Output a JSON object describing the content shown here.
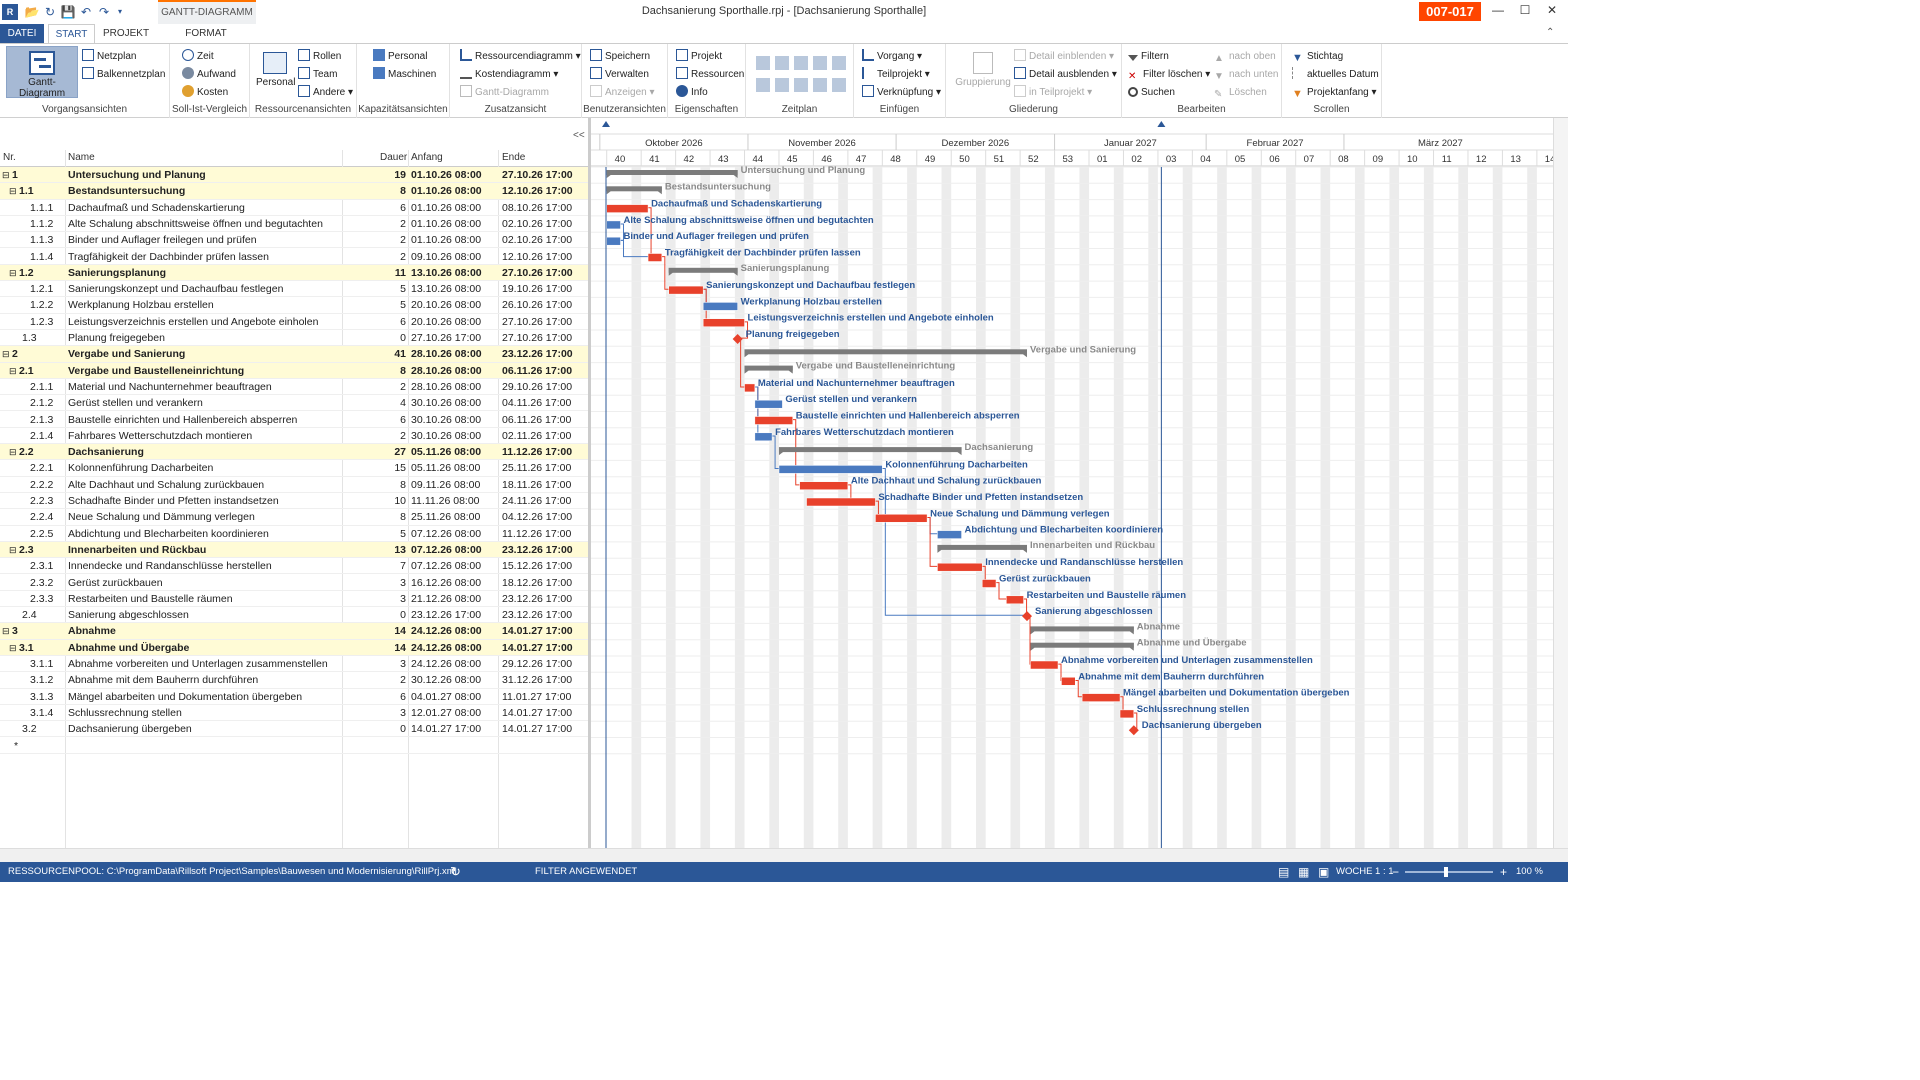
{
  "titlebar": {
    "title": "Dachsanierung Sporthalle.rpj - [Dachsanierung Sporthalle]",
    "badge": "007-017",
    "context_tab": "GANTT-DIAGRAMM"
  },
  "tabs": {
    "file": "DATEI",
    "start": "START",
    "projekt": "PROJEKT",
    "format": "FORMAT"
  },
  "ribbon": {
    "vorgang": {
      "label": "Vorgangsansichten",
      "gantt": "Gantt-Diagramm",
      "netzplan": "Netzplan",
      "balken": "Balkennetzplan"
    },
    "sollist": {
      "label": "Soll-Ist-Vergleich",
      "zeit": "Zeit",
      "aufwand": "Aufwand",
      "kosten": "Kosten"
    },
    "ressource": {
      "label": "Ressourcenansichten",
      "personal": "Personal",
      "rollen": "Rollen",
      "team": "Team",
      "andere": "Andere"
    },
    "kapazitaet": {
      "label": "Kapazitätsansichten",
      "personal": "Personal",
      "maschinen": "Maschinen"
    },
    "zusatz": {
      "label": "Zusatzansicht",
      "ressdiag": "Ressourcendiagramm",
      "kostendiag": "Kostendiagramm",
      "gantt": "Gantt-Diagramm"
    },
    "benutzer": {
      "label": "Benutzeransichten",
      "speichern": "Speichern",
      "verwalten": "Verwalten",
      "anzeigen": "Anzeigen"
    },
    "eigen": {
      "label": "Eigenschaften",
      "projekt": "Projekt",
      "ressourcen": "Ressourcen",
      "info": "Info"
    },
    "zeitplan": {
      "label": "Zeitplan"
    },
    "einfuegen": {
      "label": "Einfügen",
      "vorgang": "Vorgang",
      "teilprojekt": "Teilprojekt",
      "verknuepfung": "Verknüpfung"
    },
    "gliederung": {
      "label": "Gliederung",
      "gruppierung": "Gruppierung",
      "detail_ein": "Detail einblenden",
      "detail_aus": "Detail ausblenden",
      "in_teil": "in Teilprojekt"
    },
    "bearbeiten": {
      "label": "Bearbeiten",
      "filtern": "Filtern",
      "filter_loeschen": "Filter löschen",
      "suchen": "Suchen",
      "nach_oben": "nach oben",
      "nach_unten": "nach unten",
      "loeschen": "Löschen"
    },
    "scrollen": {
      "label": "Scrollen",
      "stichtag": "Stichtag",
      "aktuelles": "aktuelles Datum",
      "projektanfang": "Projektanfang"
    }
  },
  "table": {
    "headers": {
      "nr": "Nr.",
      "name": "Name",
      "dauer": "Dauer",
      "anfang": "Anfang",
      "ende": "Ende"
    },
    "collapse": "<<",
    "new_row": "*",
    "rows": [
      {
        "nr": "1",
        "name": "Untersuchung und Planung",
        "dur": "19",
        "start": "01.10.26 08:00",
        "end": "27.10.26 17:00",
        "lvl": 0,
        "sum": true,
        "s": 0,
        "e": 3.8
      },
      {
        "nr": "1.1",
        "name": "Bestandsuntersuchung",
        "dur": "8",
        "start": "01.10.26 08:00",
        "end": "12.10.26 17:00",
        "lvl": 1,
        "sum": true,
        "s": 0,
        "e": 1.6
      },
      {
        "nr": "1.1.1",
        "name": "Dachaufmaß und Schadenskartierung",
        "dur": "6",
        "start": "01.10.26 08:00",
        "end": "08.10.26 17:00",
        "lvl": 2,
        "c": "r",
        "s": 0,
        "e": 1.2
      },
      {
        "nr": "1.1.2",
        "name": "Alte Schalung abschnittsweise öffnen und begutachten",
        "dur": "2",
        "start": "01.10.26 08:00",
        "end": "02.10.26 17:00",
        "lvl": 2,
        "c": "b",
        "s": 0,
        "e": 0.4
      },
      {
        "nr": "1.1.3",
        "name": "Binder und Auflager freilegen und prüfen",
        "dur": "2",
        "start": "01.10.26 08:00",
        "end": "02.10.26 17:00",
        "lvl": 2,
        "c": "b",
        "s": 0,
        "e": 0.4
      },
      {
        "nr": "1.1.4",
        "name": "Tragfähigkeit der Dachbinder prüfen lassen",
        "dur": "2",
        "start": "09.10.26 08:00",
        "end": "12.10.26 17:00",
        "lvl": 2,
        "c": "r",
        "s": 1.2,
        "e": 1.6
      },
      {
        "nr": "1.2",
        "name": "Sanierungsplanung",
        "dur": "11",
        "start": "13.10.26 08:00",
        "end": "27.10.26 17:00",
        "lvl": 1,
        "sum": true,
        "s": 1.8,
        "e": 3.8
      },
      {
        "nr": "1.2.1",
        "name": "Sanierungskonzept und Dachaufbau festlegen",
        "dur": "5",
        "start": "13.10.26 08:00",
        "end": "19.10.26 17:00",
        "lvl": 2,
        "c": "r",
        "s": 1.8,
        "e": 2.8
      },
      {
        "nr": "1.2.2",
        "name": "Werkplanung Holzbau erstellen",
        "dur": "5",
        "start": "20.10.26 08:00",
        "end": "26.10.26 17:00",
        "lvl": 2,
        "c": "b",
        "s": 2.8,
        "e": 3.8
      },
      {
        "nr": "1.2.3",
        "name": "Leistungsverzeichnis erstellen und Angebote einholen",
        "dur": "6",
        "start": "20.10.26 08:00",
        "end": "27.10.26 17:00",
        "lvl": 2,
        "c": "r",
        "s": 2.8,
        "e": 4.0
      },
      {
        "nr": "1.3",
        "name": "Planung freigegeben",
        "dur": "0",
        "start": "27.10.26 17:00",
        "end": "27.10.26 17:00",
        "lvl": 1,
        "ms": true,
        "s": 3.8,
        "e": 3.8
      },
      {
        "nr": "2",
        "name": "Vergabe und Sanierung",
        "dur": "41",
        "start": "28.10.26 08:00",
        "end": "23.12.26 17:00",
        "lvl": 0,
        "sum": true,
        "s": 4.0,
        "e": 12.2
      },
      {
        "nr": "2.1",
        "name": "Vergabe und Baustelleneinrichtung",
        "dur": "8",
        "start": "28.10.26 08:00",
        "end": "06.11.26 17:00",
        "lvl": 1,
        "sum": true,
        "s": 4.0,
        "e": 5.4
      },
      {
        "nr": "2.1.1",
        "name": "Material und Nachunternehmer beauftragen",
        "dur": "2",
        "start": "28.10.26 08:00",
        "end": "29.10.26 17:00",
        "lvl": 2,
        "c": "r",
        "s": 4.0,
        "e": 4.3
      },
      {
        "nr": "2.1.2",
        "name": "Gerüst stellen und verankern",
        "dur": "4",
        "start": "30.10.26 08:00",
        "end": "04.11.26 17:00",
        "lvl": 2,
        "c": "b",
        "s": 4.3,
        "e": 5.1
      },
      {
        "nr": "2.1.3",
        "name": "Baustelle einrichten und Hallenbereich absperren",
        "dur": "6",
        "start": "30.10.26 08:00",
        "end": "06.11.26 17:00",
        "lvl": 2,
        "c": "r",
        "s": 4.3,
        "e": 5.4
      },
      {
        "nr": "2.1.4",
        "name": "Fahrbares Wetterschutzdach montieren",
        "dur": "2",
        "start": "30.10.26 08:00",
        "end": "02.11.26 17:00",
        "lvl": 2,
        "c": "b",
        "s": 4.3,
        "e": 4.8
      },
      {
        "nr": "2.2",
        "name": "Dachsanierung",
        "dur": "27",
        "start": "05.11.26 08:00",
        "end": "11.12.26 17:00",
        "lvl": 1,
        "sum": true,
        "s": 5.0,
        "e": 10.3
      },
      {
        "nr": "2.2.1",
        "name": "Kolonnenführung Dacharbeiten",
        "dur": "15",
        "start": "05.11.26 08:00",
        "end": "25.11.26 17:00",
        "lvl": 2,
        "c": "b",
        "s": 5.0,
        "e": 8.0
      },
      {
        "nr": "2.2.2",
        "name": "Alte Dachhaut und Schalung zurückbauen",
        "dur": "8",
        "start": "09.11.26 08:00",
        "end": "18.11.26 17:00",
        "lvl": 2,
        "c": "r",
        "s": 5.6,
        "e": 7.0
      },
      {
        "nr": "2.2.3",
        "name": "Schadhafte Binder und Pfetten instandsetzen",
        "dur": "10",
        "start": "11.11.26 08:00",
        "end": "24.11.26 17:00",
        "lvl": 2,
        "c": "r",
        "s": 5.8,
        "e": 7.8
      },
      {
        "nr": "2.2.4",
        "name": "Neue Schalung und Dämmung verlegen",
        "dur": "8",
        "start": "25.11.26 08:00",
        "end": "04.12.26 17:00",
        "lvl": 2,
        "c": "r",
        "s": 7.8,
        "e": 9.3
      },
      {
        "nr": "2.2.5",
        "name": "Abdichtung und Blecharbeiten koordinieren",
        "dur": "5",
        "start": "07.12.26 08:00",
        "end": "11.12.26 17:00",
        "lvl": 2,
        "c": "b",
        "s": 9.6,
        "e": 10.3
      },
      {
        "nr": "2.3",
        "name": "Innenarbeiten und Rückbau",
        "dur": "13",
        "start": "07.12.26 08:00",
        "end": "23.12.26 17:00",
        "lvl": 1,
        "sum": true,
        "s": 9.6,
        "e": 12.2
      },
      {
        "nr": "2.3.1",
        "name": "Innendecke und Randanschlüsse herstellen",
        "dur": "7",
        "start": "07.12.26 08:00",
        "end": "15.12.26 17:00",
        "lvl": 2,
        "c": "r",
        "s": 9.6,
        "e": 10.9
      },
      {
        "nr": "2.3.2",
        "name": "Gerüst zurückbauen",
        "dur": "3",
        "start": "16.12.26 08:00",
        "end": "18.12.26 17:00",
        "lvl": 2,
        "c": "r",
        "s": 10.9,
        "e": 11.3
      },
      {
        "nr": "2.3.3",
        "name": "Restarbeiten und Baustelle räumen",
        "dur": "3",
        "start": "21.12.26 08:00",
        "end": "23.12.26 17:00",
        "lvl": 2,
        "c": "r",
        "s": 11.6,
        "e": 12.1
      },
      {
        "nr": "2.4",
        "name": "Sanierung abgeschlossen",
        "dur": "0",
        "start": "23.12.26 17:00",
        "end": "23.12.26 17:00",
        "lvl": 1,
        "ms": true,
        "s": 12.2,
        "e": 12.2
      },
      {
        "nr": "3",
        "name": "Abnahme",
        "dur": "14",
        "start": "24.12.26 08:00",
        "end": "14.01.27 17:00",
        "lvl": 0,
        "sum": true,
        "s": 12.3,
        "e": 15.3
      },
      {
        "nr": "3.1",
        "name": "Abnahme und Übergabe",
        "dur": "14",
        "start": "24.12.26 08:00",
        "end": "14.01.27 17:00",
        "lvl": 1,
        "sum": true,
        "s": 12.3,
        "e": 15.3
      },
      {
        "nr": "3.1.1",
        "name": "Abnahme vorbereiten und Unterlagen zusammenstellen",
        "dur": "3",
        "start": "24.12.26 08:00",
        "end": "29.12.26 17:00",
        "lvl": 2,
        "c": "r",
        "s": 12.3,
        "e": 13.1
      },
      {
        "nr": "3.1.2",
        "name": "Abnahme mit dem Bauherrn durchführen",
        "dur": "2",
        "start": "30.12.26 08:00",
        "end": "31.12.26 17:00",
        "lvl": 2,
        "c": "r",
        "s": 13.2,
        "e": 13.6
      },
      {
        "nr": "3.1.3",
        "name": "Mängel abarbeiten und Dokumentation übergeben",
        "dur": "6",
        "start": "04.01.27 08:00",
        "end": "11.01.27 17:00",
        "lvl": 2,
        "c": "r",
        "s": 13.8,
        "e": 14.9
      },
      {
        "nr": "3.1.4",
        "name": "Schlussrechnung stellen",
        "dur": "3",
        "start": "12.01.27 08:00",
        "end": "14.01.27 17:00",
        "lvl": 2,
        "c": "r",
        "s": 14.9,
        "e": 15.3
      },
      {
        "nr": "3.2",
        "name": "Dachsanierung übergeben",
        "dur": "0",
        "start": "14.01.27 17:00",
        "end": "14.01.27 17:00",
        "lvl": 1,
        "ms": true,
        "s": 15.3,
        "e": 15.3
      }
    ]
  },
  "timeline": {
    "months": [
      {
        "label": "Oktober 2026",
        "s": -0.2,
        "e": 4.1
      },
      {
        "label": "November 2026",
        "s": 4.1,
        "e": 8.4
      },
      {
        "label": "Dezember 2026",
        "s": 8.4,
        "e": 13.0
      },
      {
        "label": "Januar 2027",
        "s": 13.0,
        "e": 17.4
      },
      {
        "label": "Februar 2027",
        "s": 17.4,
        "e": 21.4
      },
      {
        "label": "März 2027",
        "s": 21.4,
        "e": 27
      }
    ],
    "weeks": [
      "40",
      "41",
      "42",
      "43",
      "44",
      "45",
      "46",
      "47",
      "48",
      "49",
      "50",
      "51",
      "52",
      "53",
      "01",
      "02",
      "03",
      "04",
      "05",
      "06",
      "07",
      "08",
      "09",
      "10",
      "11",
      "12",
      "13",
      "14"
    ],
    "today_week": 16.1,
    "start_week": -0.05
  },
  "colors": {
    "accent": "#2b5797",
    "critical": "#e8412b",
    "normal": "#4a7ac0",
    "summary": "#7b7b7b",
    "label": "#2b5797",
    "summary_label": "#8a8a8a",
    "weekend": "#ececec",
    "summary_row": "#fffbd6"
  },
  "status": {
    "pool": "RESSOURCENPOOL: C:\\ProgramData\\Rillsoft Project\\Samples\\Bauwesen und Modernisierung\\RillPrj.xml",
    "filter": "FILTER ANGEWENDET",
    "zoom_label": "WOCHE 1 : 1",
    "zoom_pct": "100 %",
    "zoom_minus": "−",
    "zoom_plus": "+"
  }
}
